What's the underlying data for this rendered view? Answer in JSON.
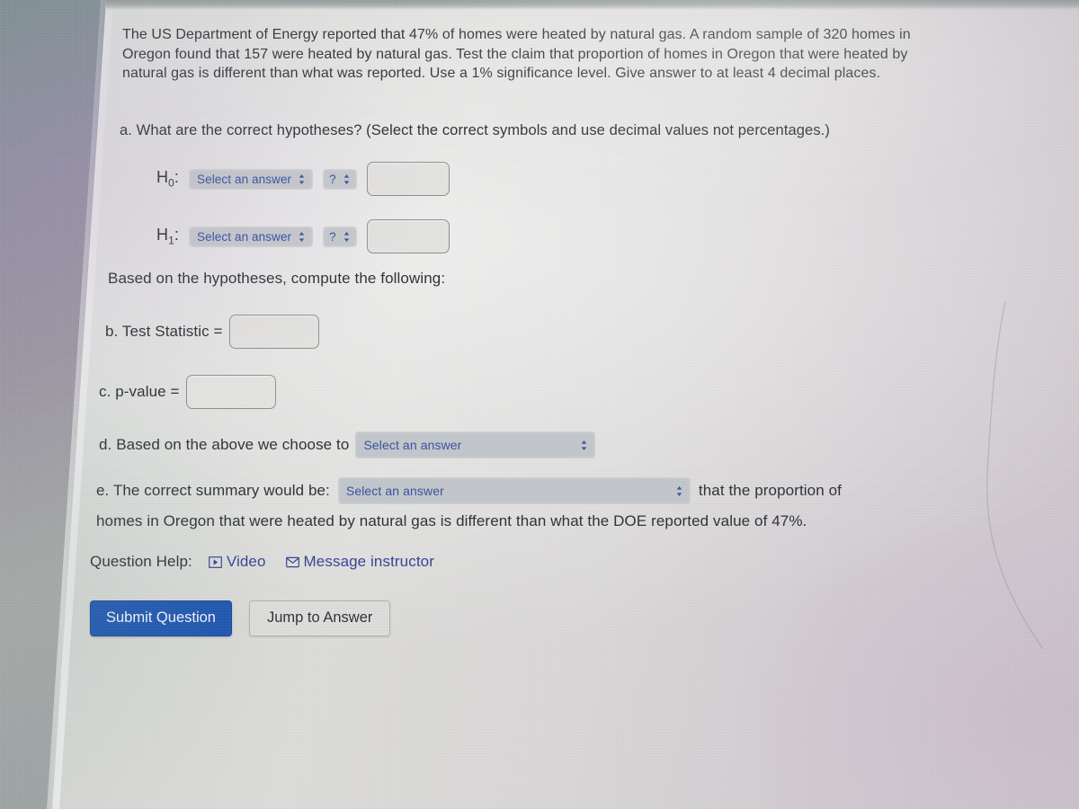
{
  "question": {
    "prompt": "The US Department of Energy reported that 47% of homes were heated by natural gas. A random sample of 320 homes in Oregon found that 157 were heated by natural gas. Test the claim that proportion of homes in Oregon that were heated by natural gas is different than what was reported. Use a 1% significance level. Give answer to at least 4 decimal places.",
    "part_a": "a. What are the correct hypotheses? (Select the correct symbols and use decimal values not percentages.)",
    "h0_label": "H",
    "h0_sub": "0",
    "h0_colon": ":",
    "h1_label": "H",
    "h1_sub": "1",
    "h1_colon": ":",
    "select_placeholder": "Select an answer",
    "symbol_placeholder": "?",
    "h0_value": "",
    "h0_symbol_value": "",
    "h0_answer_value": "",
    "h1_value": "",
    "h1_symbol_value": "",
    "h1_answer_value": "",
    "based_on": "Based on the hypotheses, compute the following:",
    "part_b_label": "b. Test Statistic =",
    "part_b_value": "",
    "part_c_label": "c. p-value =",
    "part_c_value": "",
    "part_d_label": "d. Based on the above we choose to",
    "part_d_value": "Select an answer",
    "part_e_label": "e. The correct summary would be:",
    "part_e_value": "Select an answer",
    "part_e_tail": "that the proportion of",
    "part_e_line2": "homes in Oregon that were heated by natural gas is different than what the DOE reported value of 47%."
  },
  "help": {
    "label": "Question Help:",
    "video": "Video",
    "message": "Message instructor"
  },
  "buttons": {
    "submit": "Submit Question",
    "jump": "Jump to Answer"
  },
  "colors": {
    "primary_button": "#1a55b8",
    "link": "#39439c",
    "select_text": "#3352a6",
    "select_bg": "#c3c7cb",
    "body_text": "#2e3335"
  }
}
